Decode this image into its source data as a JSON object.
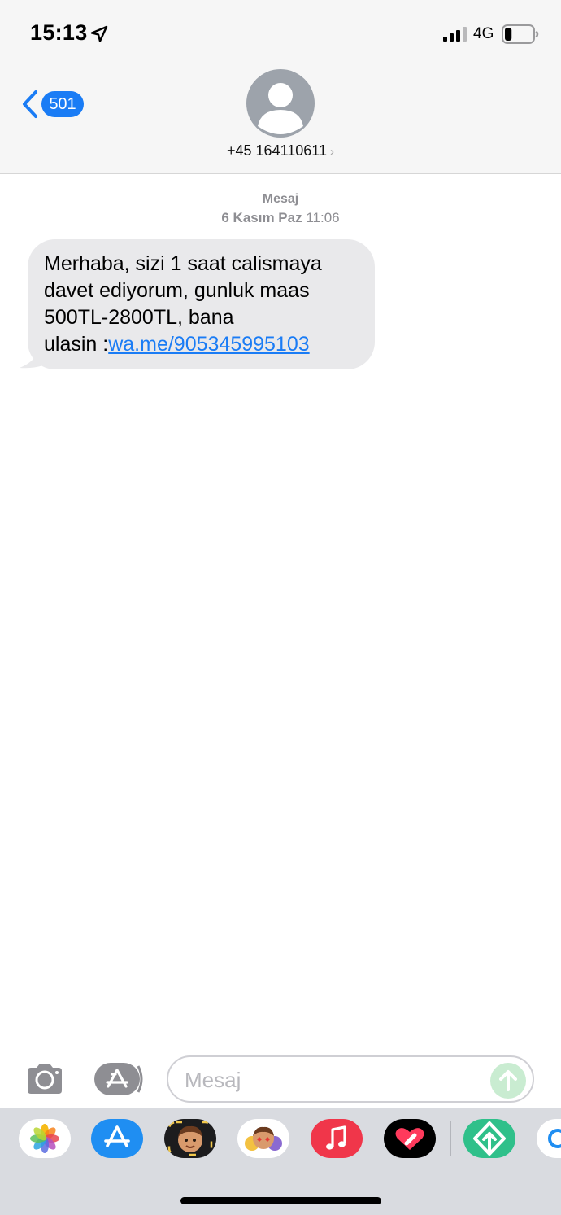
{
  "status_bar": {
    "time": "15:13",
    "network": "4G",
    "location_icon": "location-arrow-icon",
    "signal_icon": "signal-bars-icon",
    "battery_icon": "battery-icon",
    "battery_level": 0.25
  },
  "nav": {
    "back_icon": "chevron-left-icon",
    "back_badge": "501",
    "avatar_icon": "person-silhouette-icon",
    "contact": "+45 164110611",
    "contact_chevron": "›"
  },
  "thread": {
    "service_label": "Mesaj",
    "date_day": "6 Kasım Paz",
    "date_time": "11:06",
    "message": {
      "text": "Merhaba, sizi 1 saat calismaya\ndavet ediyorum, gunluk maas\n500TL-2800TL, bana\nulasin :",
      "link": "wa.me/905345995103"
    }
  },
  "input_bar": {
    "placeholder": "Mesaj",
    "camera_icon": "camera-icon",
    "apps_icon": "app-store-icon",
    "send_icon": "arrow-up-icon"
  },
  "app_drawer": {
    "apps": [
      "photos-icon",
      "app-store-icon",
      "memoji-icon",
      "animoji-stickers-icon",
      "music-icon",
      "digital-touch-icon",
      "green-app-icon",
      "partial-app-icon"
    ]
  },
  "colors": {
    "accent": "#1a7cf5",
    "bubble_gray": "#e9e9eb",
    "header_bg": "#f6f6f6",
    "drawer_bg": "#d9dbe0"
  }
}
